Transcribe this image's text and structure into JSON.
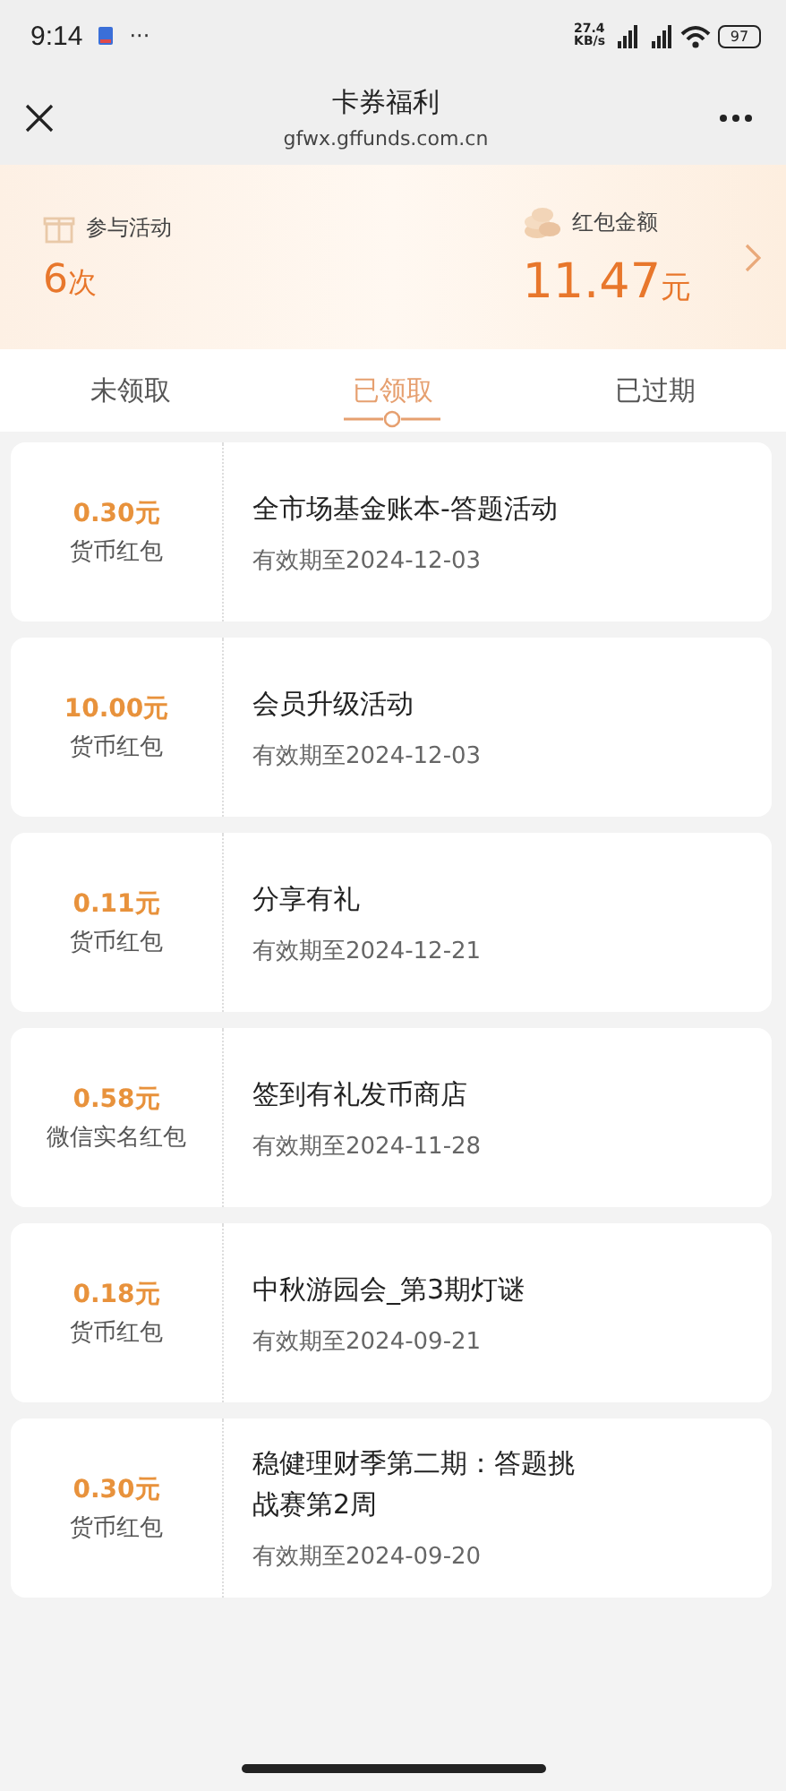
{
  "status_bar": {
    "time": "9:14",
    "more": "···",
    "speed": "27.4",
    "speed_unit": "KB/s",
    "battery": "97"
  },
  "nav": {
    "title": "卡券福利",
    "subtitle": "gfwx.gffunds.com.cn"
  },
  "summary": [
    {
      "kind": "gift",
      "label": "参与活动",
      "value": "6",
      "unit": "次"
    },
    {
      "kind": "coins",
      "label": "红包金额",
      "value": "11.47",
      "unit": "元"
    }
  ],
  "tabs": [
    {
      "label": "未领取",
      "selected": false
    },
    {
      "label": "已领取",
      "selected": true
    },
    {
      "label": "已过期",
      "selected": false
    }
  ],
  "coupons": [
    {
      "amount": "0.30元",
      "type": "货币红包",
      "title": "全市场基金账本-答题活动",
      "validity": "有效期至2024-12-03"
    },
    {
      "amount": "10.00元",
      "type": "货币红包",
      "title": "会员升级活动",
      "validity": "有效期至2024-12-03"
    },
    {
      "amount": "0.11元",
      "type": "货币红包",
      "title": "分享有礼",
      "validity": "有效期至2024-12-21"
    },
    {
      "amount": "0.58元",
      "type": "微信实名红包",
      "title": "签到有礼发币商店",
      "validity": "有效期至2024-11-28"
    },
    {
      "amount": "0.18元",
      "type": "货币红包",
      "title": "中秋游园会_第3期灯谜",
      "validity": "有效期至2024-09-21"
    },
    {
      "amount": "0.30元",
      "type": "货币红包",
      "title": "稳健理财季第二期：答题挑战赛第2周",
      "validity": "有效期至2024-09-20"
    }
  ]
}
